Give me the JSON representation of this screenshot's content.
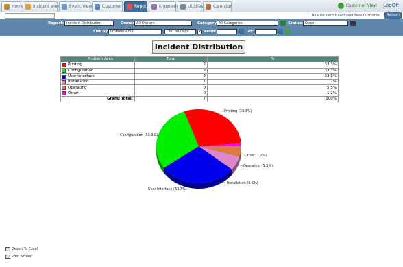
{
  "tabs": [
    {
      "label": "Home",
      "icon": "home-icon",
      "color": "#c48a3a"
    },
    {
      "label": "Incident View",
      "icon": "incident-icon",
      "color": "#d9a040"
    },
    {
      "label": "Event View",
      "icon": "event-icon",
      "color": "#6a9ad0"
    },
    {
      "label": "Customer View",
      "icon": "customer-icon",
      "color": "#5b8bc0"
    },
    {
      "label": "Report",
      "icon": "report-icon",
      "color": "#e05050"
    },
    {
      "label": "Knowledge",
      "icon": "knowledge-icon",
      "color": "#8a7ab0"
    },
    {
      "label": "Utilities",
      "icon": "utilities-icon",
      "color": "#7a8a9a"
    },
    {
      "label": "Calendar",
      "icon": "calendar-icon",
      "color": "#c07040"
    }
  ],
  "header": {
    "user_text": "Customer View",
    "logoff": "LogOff",
    "menu_select": "",
    "links": "New Incident  New Event  New Customer",
    "refresh": "Refresh"
  },
  "filters": {
    "report_label": "Report:",
    "report_value": "Incident Distribution",
    "owner_label": "Owner:",
    "owner_value": "All Owners",
    "category_label": "Category:",
    "category_value": "All Categories",
    "status_label": "Status:",
    "status_value": "Open",
    "list_by_label": "List By:",
    "list_by_value": "Problem Area",
    "period_value": "Last 30 Days",
    "from_label": "From:",
    "to_label": "To:"
  },
  "report": {
    "title": "Incident Distribution",
    "col_area": "Problem Area",
    "col_total": "Total",
    "col_pct": "%",
    "rows": [
      {
        "name": "Printing",
        "total": "2",
        "pct": "33.3%",
        "color": "#ff0000"
      },
      {
        "name": "Configuration",
        "total": "2",
        "pct": "33.3%",
        "color": "#00ee00"
      },
      {
        "name": "User Interface",
        "total": "2",
        "pct": "33.3%",
        "color": "#0000ee"
      },
      {
        "name": "Installation",
        "total": "1",
        "pct": "7%",
        "color": "#dd88cc"
      },
      {
        "name": "Operating",
        "total": "0",
        "pct": "5.5%",
        "color": "#dd7a40"
      },
      {
        "name": "Other",
        "total": "0",
        "pct": "1.2%",
        "color": "#ff00ff"
      }
    ],
    "grand_total_label": "Grand Total:",
    "grand_total": "7",
    "grand_pct": "100%"
  },
  "chart_data": {
    "type": "pie",
    "title": "",
    "categories": [
      "Printing",
      "Configuration",
      "User Interface",
      "Installation",
      "Operating",
      "Other"
    ],
    "values": [
      33.3,
      33.3,
      33.3,
      7,
      5.5,
      1.2
    ],
    "labels": [
      "Printing (33.3%)",
      "Configuration (33.3%)",
      "User Interface (33.3%)",
      "Installation (9.5%)",
      "Operating (5.5%)",
      "Other (1.2%)"
    ],
    "colors": [
      "#ff0000",
      "#00ee00",
      "#0000ee",
      "#dd88cc",
      "#dd7a40",
      "#ff00ff"
    ]
  },
  "footer": {
    "export": "Export To Excel",
    "print": "Print Screen"
  }
}
